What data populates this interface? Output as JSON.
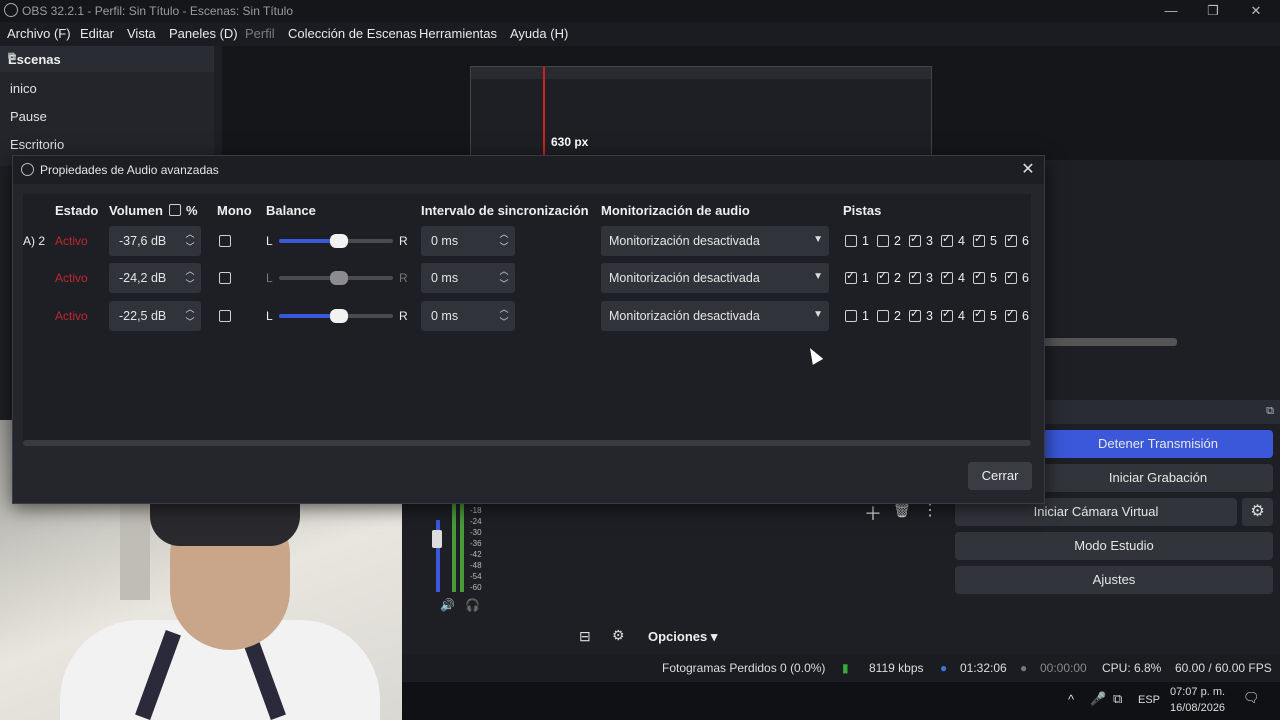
{
  "window": {
    "title": "OBS 32.2.1 - Perfil: Sin Título - Escenas: Sin Título",
    "min": "—",
    "max": "❐",
    "close": "✕"
  },
  "menu": [
    {
      "label": "Archivo (F)",
      "disabled": false
    },
    {
      "label": "Editar",
      "disabled": false
    },
    {
      "label": "Vista",
      "disabled": false
    },
    {
      "label": "Paneles (D)",
      "disabled": false
    },
    {
      "label": "Perfil",
      "disabled": true
    },
    {
      "label": "Colección de Escenas",
      "disabled": false
    },
    {
      "label": "Herramientas",
      "disabled": false
    },
    {
      "label": "Ayuda (H)",
      "disabled": false
    }
  ],
  "scenes": {
    "title": "Escenas",
    "items": [
      "inico",
      "Pause",
      "Escritorio"
    ]
  },
  "preview": {
    "size_label": "630 px"
  },
  "dialog": {
    "title": "Propiedades de Audio avanzadas",
    "close": "✕",
    "headers": {
      "estado": "Estado",
      "volumen": "Volumen",
      "percent": "%",
      "mono": "Mono",
      "balance": "Balance",
      "sync": "Intervalo de sincronización",
      "monitor": "Monitorización de audio",
      "pistas": "Pistas"
    },
    "rows": [
      {
        "label": "A) 2",
        "status": "Activo",
        "volume": "-37,6 dB",
        "mono": false,
        "bal_L": "L",
        "bal_R": "R",
        "balance_enabled": true,
        "balance": 0.5,
        "sync": "0 ms",
        "monitor": "Monitorización desactivada",
        "tracks": [
          false,
          false,
          true,
          true,
          true,
          true
        ]
      },
      {
        "label": "",
        "status": "Activo",
        "volume": "-24,2 dB",
        "mono": false,
        "bal_L": "L",
        "bal_R": "R",
        "balance_enabled": false,
        "balance": 0.5,
        "sync": "0 ms",
        "monitor": "Monitorización desactivada",
        "tracks": [
          true,
          true,
          true,
          true,
          true,
          true
        ]
      },
      {
        "label": "",
        "status": "Activo",
        "volume": "-22,5 dB",
        "mono": false,
        "bal_L": "L",
        "bal_R": "R",
        "balance_enabled": true,
        "balance": 0.5,
        "sync": "0 ms",
        "monitor": "Monitorización desactivada",
        "tracks": [
          false,
          false,
          true,
          true,
          true,
          true
        ]
      }
    ],
    "track_numbers": [
      "1",
      "2",
      "3",
      "4",
      "5",
      "6"
    ],
    "close_button": "Cerrar"
  },
  "controls": {
    "stop_stream": "Detener Transmisión",
    "start_recording": "Iniciar Grabación",
    "virtual_cam": "Iniciar Cámara Virtual",
    "studio_mode": "Modo Estudio",
    "settings": "Ajustes"
  },
  "mixer": {
    "options": "Opciones",
    "db_marks": [
      "-18",
      "-24",
      "-30",
      "-36",
      "-42",
      "-48",
      "-54",
      "-60"
    ]
  },
  "status": {
    "dropped": "Fotogramas Perdidos 0 (0.0%)",
    "bitrate": "8119 kbps",
    "stream_time": "01:32:06",
    "rec_time": "00:00:00",
    "cpu": "CPU: 6.8%",
    "fps": "60.00 / 60.00 FPS"
  },
  "taskbar": {
    "lang": "ESP",
    "time": "07:07 p. m.",
    "date": "16/08/2026"
  },
  "colors": {
    "accent": "#3a58d9",
    "active_red": "#c0272d"
  }
}
